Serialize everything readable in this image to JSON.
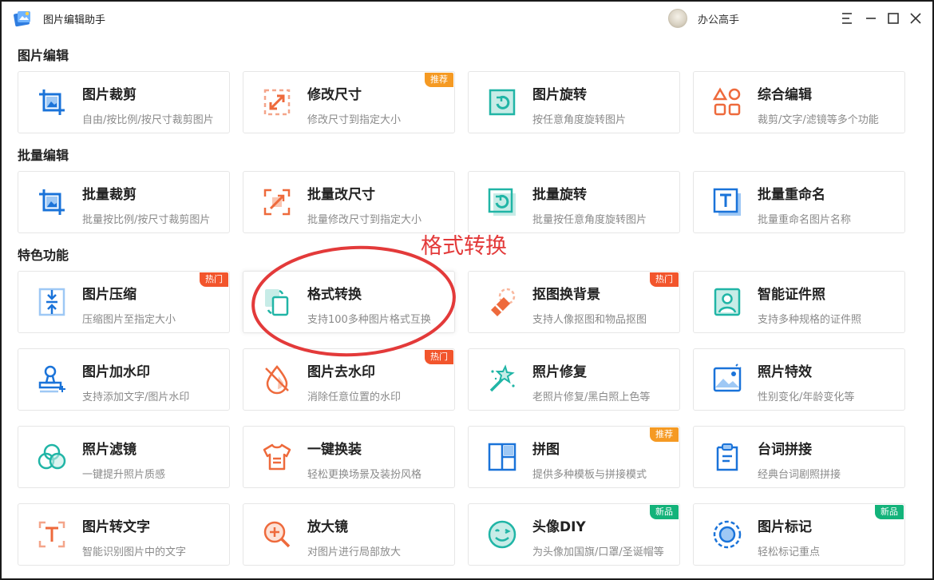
{
  "window": {
    "title": "图片编辑助手",
    "user": "办公高手"
  },
  "sections": [
    {
      "title": "图片编辑"
    },
    {
      "title": "批量编辑"
    },
    {
      "title": "特色功能"
    }
  ],
  "cards": [
    {
      "title": "图片裁剪",
      "desc": "自由/按比例/按尺寸裁剪图片",
      "icon": "crop-icon",
      "badge": ""
    },
    {
      "title": "修改尺寸",
      "desc": "修改尺寸到指定大小",
      "icon": "resize-icon",
      "badge": "推荐"
    },
    {
      "title": "图片旋转",
      "desc": "按任意角度旋转图片",
      "icon": "rotate-icon",
      "badge": ""
    },
    {
      "title": "综合编辑",
      "desc": "裁剪/文字/滤镜等多个功能",
      "icon": "shapes-icon",
      "badge": ""
    },
    {
      "title": "批量裁剪",
      "desc": "批量按比例/按尺寸裁剪图片",
      "icon": "batch-crop-icon",
      "badge": ""
    },
    {
      "title": "批量改尺寸",
      "desc": "批量修改尺寸到指定大小",
      "icon": "batch-resize-icon",
      "badge": ""
    },
    {
      "title": "批量旋转",
      "desc": "批量按任意角度旋转图片",
      "icon": "batch-rotate-icon",
      "badge": ""
    },
    {
      "title": "批量重命名",
      "desc": "批量重命名图片名称",
      "icon": "rename-icon",
      "badge": ""
    },
    {
      "title": "图片压缩",
      "desc": "压缩图片至指定大小",
      "icon": "compress-icon",
      "badge": "热门"
    },
    {
      "title": "格式转换",
      "desc": "支持100多种图片格式互换",
      "icon": "convert-icon",
      "badge": ""
    },
    {
      "title": "抠图换背景",
      "desc": "支持人像抠图和物品抠图",
      "icon": "eraser-icon",
      "badge": "热门"
    },
    {
      "title": "智能证件照",
      "desc": "支持多种规格的证件照",
      "icon": "id-photo-icon",
      "badge": ""
    },
    {
      "title": "图片加水印",
      "desc": "支持添加文字/图片水印",
      "icon": "stamp-icon",
      "badge": ""
    },
    {
      "title": "图片去水印",
      "desc": "消除任意位置的水印",
      "icon": "no-drop-icon",
      "badge": "热门"
    },
    {
      "title": "照片修复",
      "desc": "老照片修复/黑白照上色等",
      "icon": "magic-wand-icon",
      "badge": ""
    },
    {
      "title": "照片特效",
      "desc": "性别变化/年龄变化等",
      "icon": "landscape-icon",
      "badge": ""
    },
    {
      "title": "照片滤镜",
      "desc": "一键提升照片质感",
      "icon": "filter-icon",
      "badge": ""
    },
    {
      "title": "一键换装",
      "desc": "轻松更换场景及装扮风格",
      "icon": "tshirt-icon",
      "badge": ""
    },
    {
      "title": "拼图",
      "desc": "提供多种模板与拼接模式",
      "icon": "collage-icon",
      "badge": "推荐"
    },
    {
      "title": "台词拼接",
      "desc": "经典台词剧照拼接",
      "icon": "clipboard-icon",
      "badge": ""
    },
    {
      "title": "图片转文字",
      "desc": "智能识别图片中的文字",
      "icon": "ocr-icon",
      "badge": ""
    },
    {
      "title": "放大镜",
      "desc": "对图片进行局部放大",
      "icon": "zoom-icon",
      "badge": ""
    },
    {
      "title": "头像DIY",
      "desc": "为头像加国旗/口罩/圣诞帽等",
      "icon": "smile-icon",
      "badge": "新品"
    },
    {
      "title": "图片标记",
      "desc": "轻松标记重点",
      "icon": "target-icon",
      "badge": "新品"
    }
  ],
  "annotation": {
    "text": "格式转换",
    "color": "#e33a3a"
  },
  "colors": {
    "blue": "#1a73d9",
    "orange": "#ee6a3c",
    "teal": "#20b5a6",
    "hot": "#f2552c",
    "recommend": "#f59a23",
    "new": "#13b37a"
  }
}
